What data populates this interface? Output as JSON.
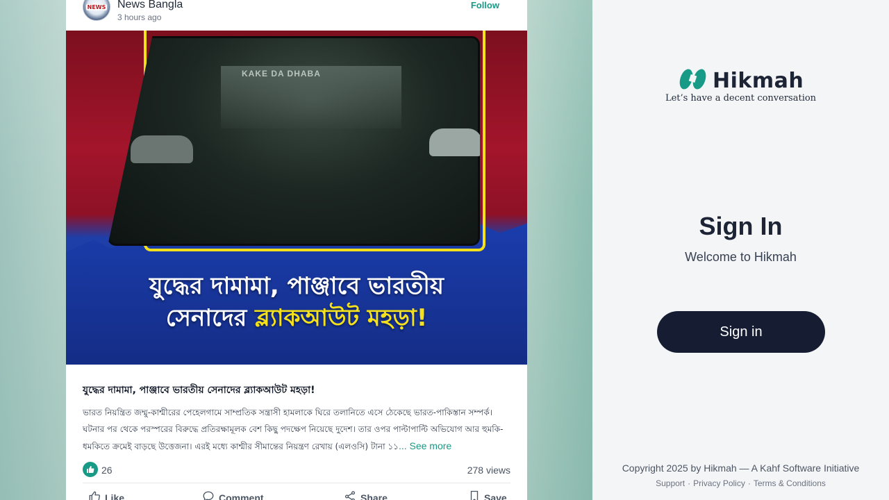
{
  "post": {
    "author": "News Bangla",
    "avatar_text": "NEWS",
    "time": "3 hours ago",
    "follow_label": "Follow",
    "image": {
      "sign_text": "KAKE DA DHABA",
      "headline_line1": "যুদ্ধের দামামা, পাঞ্জাবে ভারতীয়",
      "headline_line2_white": "সেনাদের ",
      "headline_line2_yellow": "ব্ল্যাকআউট মহড়া!"
    },
    "title": "যুদ্ধের দামামা, পাঞ্জাবে ভারতীয় সেনাদের ব্ল্যাকআউট মহড়া!",
    "body": "ভারত নিয়ন্ত্রিত জম্মু-কাশ্মীরের পেহেলগামে সাম্প্রতিক সন্ত্রাসী হামলাকে ঘিরে তলানিতে এসে ঠেকেছে ভারত-পাকিস্তান সম্পর্ক। ঘটনার পর থেকে পরস্পরের বিরুদ্ধে প্রতিরক্ষামূলক বেশ কিছু পদক্ষেপ নিয়েছে দুদেশ। তার ওপর পাল্টাপাল্টি অভিযোগ আর হুমকি-ধমকিতে ক্রমেই বাড়ছে উত্তেজনা। এরই মধ্যে কাশ্মীর সীমান্তের নিয়ন্ত্রণ রেখায় (এলওসি) টানা ১১",
    "see_more": "... See more",
    "like_count": "26",
    "views": "278 views",
    "actions": {
      "like": "Like",
      "comment": "Comment",
      "share": "Share",
      "save": "Save"
    }
  },
  "signin": {
    "logo_text": "Hikmah",
    "tagline": "Let’s have a decent conversation",
    "title": "Sign In",
    "welcome": "Welcome to Hikmah",
    "button_label": "Sign in",
    "copyright": "Copyright 2025 by Hikmah — A Kahf Software Initiative",
    "links": {
      "support": "Support",
      "privacy": "Privacy Policy",
      "terms": "Terms & Conditions",
      "separator": "·"
    }
  },
  "colors": {
    "accent": "#179a86",
    "button_bg": "#161d33",
    "headline_yellow": "#f5e11b"
  }
}
